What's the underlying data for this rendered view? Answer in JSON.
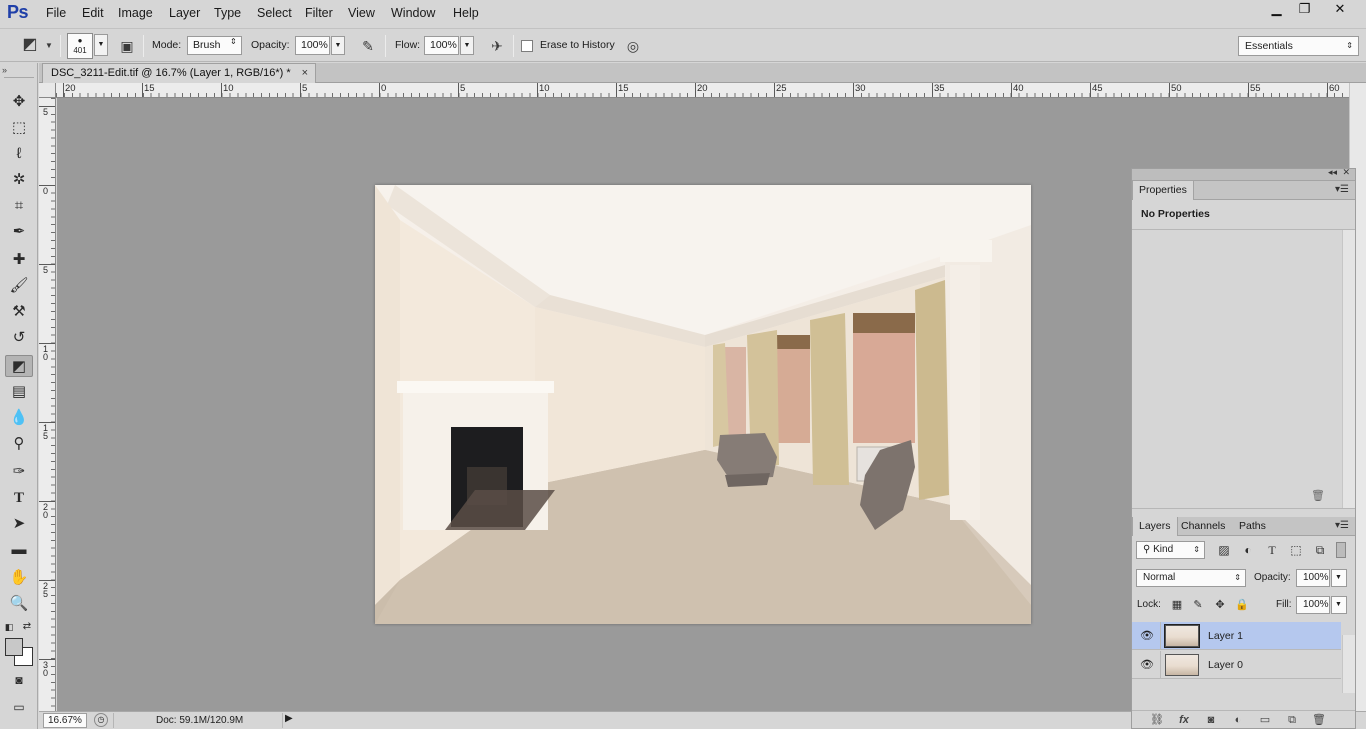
{
  "app": {
    "logo": "Ps"
  },
  "menu": [
    "File",
    "Edit",
    "Image",
    "Layer",
    "Type",
    "Select",
    "Filter",
    "View",
    "Window",
    "Help"
  ],
  "window_controls": {
    "minimize": "▁",
    "restore": "❐",
    "close": "✕"
  },
  "options": {
    "brush_size": "401",
    "mode_label": "Mode:",
    "mode_value": "Brush",
    "opacity_label": "Opacity:",
    "opacity_value": "100%",
    "flow_label": "Flow:",
    "flow_value": "100%",
    "erase_history_label": "Erase to History",
    "workspace": "Essentials"
  },
  "document": {
    "tab_title": "DSC_3211-Edit.tif @ 16.7% (Layer 1, RGB/16*) *",
    "tab_close": "×"
  },
  "ruler_top": {
    "labels": [
      "20",
      "15",
      "10",
      "5",
      "0",
      "5",
      "10",
      "15",
      "20",
      "25",
      "30",
      "35",
      "40",
      "45",
      "50",
      "55",
      "60"
    ]
  },
  "ruler_left": {
    "labels": [
      "5",
      "0",
      "5",
      "10",
      "15",
      "20",
      "25",
      "30"
    ]
  },
  "status": {
    "zoom": "16.67%",
    "doc_size": "Doc: 59.1M/120.9M"
  },
  "properties_panel": {
    "tab": "Properties",
    "empty_text": "No Properties"
  },
  "layers_panel": {
    "tabs": [
      "Layers",
      "Channels",
      "Paths"
    ],
    "filter_kind": "Kind",
    "blend_mode": "Normal",
    "opacity_label": "Opacity:",
    "opacity_value": "100%",
    "lock_label": "Lock:",
    "fill_label": "Fill:",
    "fill_value": "100%",
    "layers": [
      {
        "name": "Layer 1",
        "visible": true,
        "selected": true
      },
      {
        "name": "Layer 0",
        "visible": true,
        "selected": false
      }
    ]
  },
  "toolbar": {
    "tools": [
      "move-tool",
      "marquee-tool",
      "lasso-tool",
      "quick-selection-tool",
      "crop-tool",
      "eyedropper-tool",
      "healing-brush-tool",
      "brush-tool",
      "clone-stamp-tool",
      "history-brush-tool",
      "eraser-tool",
      "gradient-tool",
      "blur-tool",
      "dodge-tool",
      "pen-tool",
      "type-tool",
      "path-selection-tool",
      "rectangle-tool",
      "hand-tool",
      "zoom-tool"
    ],
    "active_tool": "eraser-tool",
    "foreground_color": "#c8c8c8",
    "background_color": "#ffffff"
  },
  "colors": {
    "chrome": "#d6d6d6",
    "canvas_background": "#9a9a9a",
    "selection": "#b5c8ee"
  }
}
